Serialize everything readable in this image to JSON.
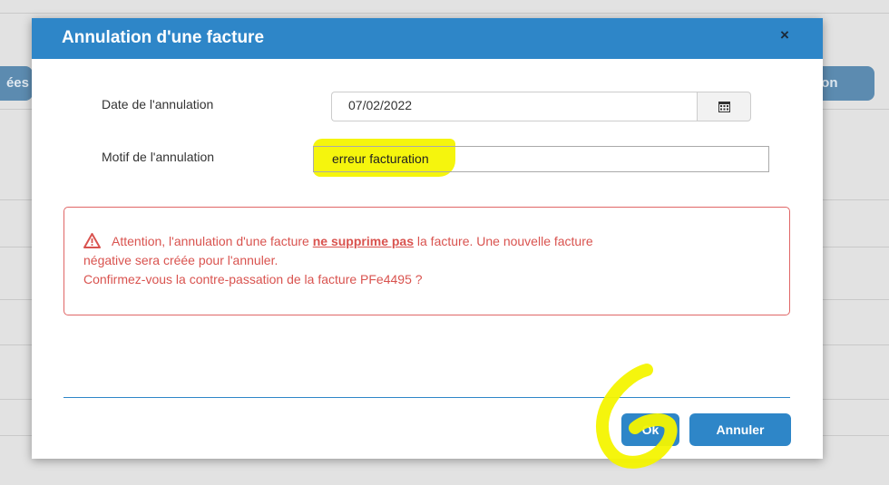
{
  "background": {
    "left_tab_label": "ées",
    "right_tab_label": "tion"
  },
  "dialog": {
    "title": "Annulation d'une facture",
    "close_glyph": "×",
    "date_label": "Date de l'annulation",
    "date_value": "07/02/2022",
    "calendar_icon": "calendar-icon",
    "motif_label": "Motif de l'annulation",
    "motif_value": "erreur facturation",
    "alert": {
      "line1_before": "Attention, l'annulation d'une facture ",
      "line1_strong": "ne supprime pas",
      "line1_after": " la facture. Une nouvelle facture",
      "line2": "négative sera créée pour l'annuler.",
      "line3": "Confirmez-vous la contre-passation de la facture PFe4495 ?",
      "icon": "warning-triangle-icon"
    },
    "ok_label": "Ok",
    "cancel_label": "Annuler"
  },
  "colors": {
    "accent": "#2e86c8",
    "alert_red": "#d9534f",
    "highlight_yellow": "#f4f400"
  }
}
